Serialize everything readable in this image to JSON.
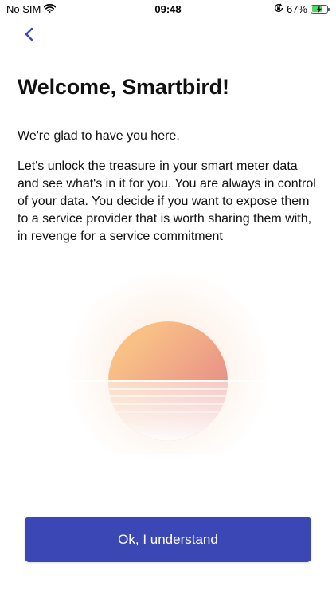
{
  "status_bar": {
    "carrier": "No SIM",
    "time": "09:48",
    "battery_percent": "67%",
    "battery_level": 0.67,
    "icons": [
      "wifi-icon",
      "orientation-lock-icon",
      "battery-charging-icon"
    ]
  },
  "navigation": {
    "back_icon": "chevron-left-icon"
  },
  "page": {
    "title": "Welcome, Smartbird!",
    "greeting": "We're glad to have you here.",
    "body": "Let's unlock the treasure in your smart meter data and see what's in it for you. You are always in control of your data. You decide if you want to expose them to a service provider that is worth sharing them with, in revenge for a service commitment"
  },
  "illustration": {
    "name": "sunset-illustration",
    "colors": {
      "sun_top": "#f9c086",
      "sun_bottom": "#e07c88",
      "glow": "#fde6d4"
    }
  },
  "actions": {
    "confirm_label": "Ok, I understand"
  },
  "colors": {
    "accent": "#3b47b5",
    "back_chevron": "#3b47b5",
    "battery_fill": "#4cd964",
    "background": "#ffffff"
  }
}
